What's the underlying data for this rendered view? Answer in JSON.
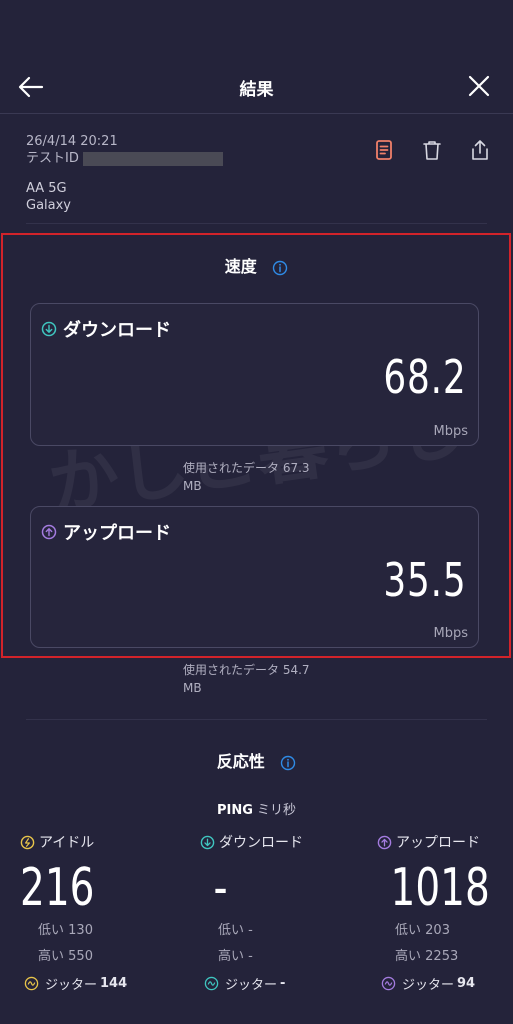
{
  "header": {
    "title": "結果"
  },
  "meta": {
    "datetime": "26/4/14 20:21",
    "test_id_label": "テストID",
    "operator": "AA 5G",
    "device": "Galaxy"
  },
  "speed": {
    "title": "速度",
    "download": {
      "label": "ダウンロード",
      "value": "68.2",
      "unit": "Mbps",
      "data_used": "使用されたデータ 67.3",
      "data_used_unit": "MB"
    },
    "upload": {
      "label": "アップロード",
      "value": "35.5",
      "unit": "Mbps",
      "data_used": "使用されたデータ 54.7",
      "data_used_unit": "MB"
    }
  },
  "responsiveness": {
    "title": "反応性",
    "ping_label": "PING",
    "ping_unit": "ミリ秒",
    "idle": {
      "label": "アイドル",
      "value": "216",
      "low_label": "低い",
      "low": "130",
      "high_label": "高い",
      "high": "550",
      "jitter_label": "ジッター",
      "jitter": "144"
    },
    "download": {
      "label": "ダウンロード",
      "value": "-",
      "low_label": "低い",
      "low": "-",
      "high_label": "高い",
      "high": "-",
      "jitter_label": "ジッター",
      "jitter": "-"
    },
    "upload": {
      "label": "アップロード",
      "value": "1018",
      "low_label": "低い",
      "low": "203",
      "high_label": "高い",
      "high": "2253",
      "jitter_label": "ジッター",
      "jitter": "94"
    }
  },
  "watermark": "かしこ暮らし",
  "colors": {
    "accent_download": "#3fc6c0",
    "accent_upload": "#a47ce0",
    "accent_idle": "#e8c54a",
    "highlight": "#d2232a",
    "info": "#2f8be6"
  }
}
